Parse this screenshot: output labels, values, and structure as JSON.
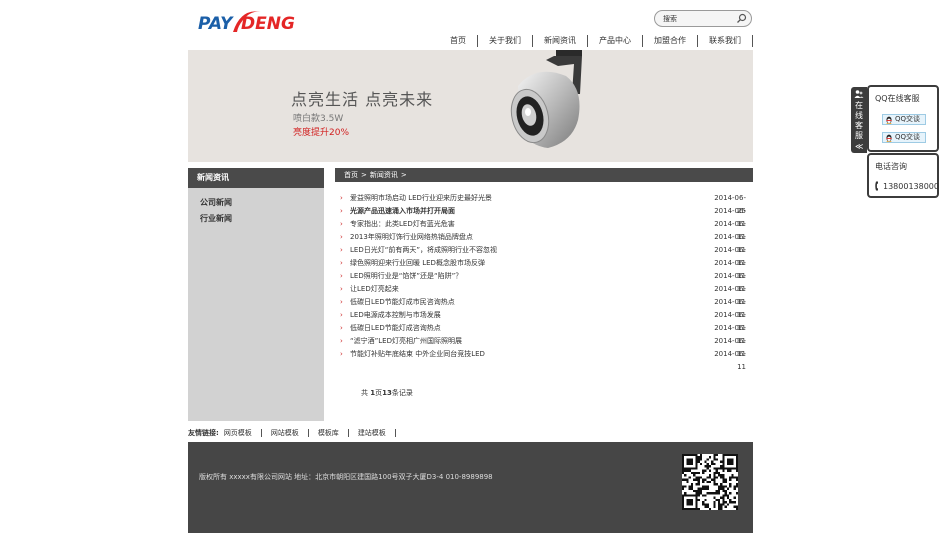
{
  "header": {
    "logo_text": "PAYDENG",
    "search": {
      "value": "搜索"
    },
    "nav": [
      "首页",
      "关于我们",
      "新闻资讯",
      "产品中心",
      "加盟合作",
      "联系我们"
    ]
  },
  "banner": {
    "title": "点亮生活 点亮未来",
    "subtitle": "喷白款3.5W",
    "highlight": "亮度提升20%"
  },
  "sidebar": {
    "header": "新闻资讯",
    "items": [
      "公司新闻",
      "行业新闻"
    ]
  },
  "breadcrumb": [
    "首页",
    ">",
    "新闻资讯",
    ">"
  ],
  "news": [
    {
      "title": "爱益照明市场启动 LED行业迎来历史最好光景",
      "date": "2014-06-25",
      "bold": false
    },
    {
      "title": "光源产品迅速涌入市场并打开局面",
      "date": "2014-06-11",
      "bold": true
    },
    {
      "title": "专家指出：此类LED灯有蓝光危害",
      "date": "2014-06-11",
      "bold": false
    },
    {
      "title": "2013年照明灯饰行业网络热销品牌盘点",
      "date": "2014-06-11",
      "bold": false
    },
    {
      "title": "LED日光灯“前有两天”，将成照明行业不容忽视",
      "date": "2014-06-11",
      "bold": false
    },
    {
      "title": "绿色照明迎来行业回暖 LED概念股市场反弹",
      "date": "2014-06-11",
      "bold": false
    },
    {
      "title": "LED照明行业是“馅饼”还是“陷阱”？",
      "date": "2014-06-11",
      "bold": false
    },
    {
      "title": "让LED灯亮起来",
      "date": "2014-06-11",
      "bold": false
    },
    {
      "title": "低碳日LED节能灯成市民咨询热点",
      "date": "2014-06-11",
      "bold": false
    },
    {
      "title": "LED电源成本控制与市场发展",
      "date": "2014-06-11",
      "bold": false
    },
    {
      "title": "低碳日LED节能灯成咨询热点",
      "date": "2014-06-11",
      "bold": false
    },
    {
      "title": "“滤宁酒”LED灯亮相广州国际照明展",
      "date": "2014-06-11",
      "bold": false
    },
    {
      "title": "节能灯补贴年底结束 中外企业同台竞技LED",
      "date": "2014-06-11",
      "bold": false
    }
  ],
  "pager": {
    "prefix": "共",
    "pages": "1",
    "mid": "页",
    "count": "13",
    "suffix": "条记录"
  },
  "friend_links": {
    "label": "友情链接:",
    "items": [
      "网页模板",
      "网站模板",
      "模板库",
      "建站模板"
    ]
  },
  "footer": {
    "text": "版权所有 xxxxx有限公司网站 地址：北京市朝阳区建国路100号双子大厦D3-4 010-8989898"
  },
  "customer_service": {
    "tab_label": "在线客服",
    "tab_arrow": "≪",
    "qq_title": "QQ在线客服",
    "qq_buttons": [
      "QQ交谈",
      "QQ交谈"
    ],
    "tel_title": "电话咨询",
    "phone": "13800138000"
  },
  "colors": {
    "brand_red": "#e42626",
    "brand_blue": "#1b5fa8",
    "dark_bar": "#4a4a4a",
    "accent_red": "#cc2222"
  }
}
